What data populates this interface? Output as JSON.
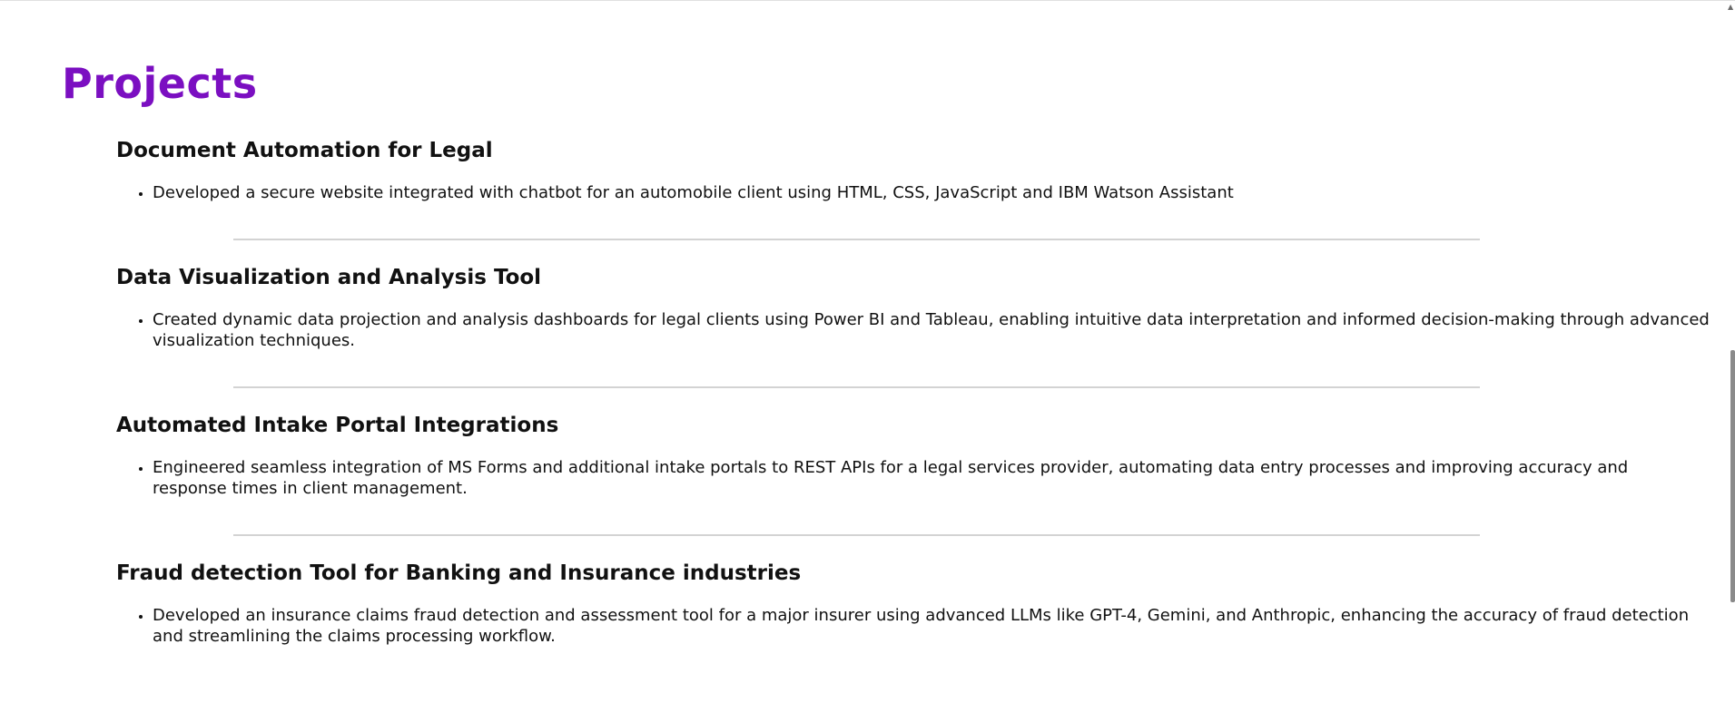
{
  "section": {
    "title": "Projects"
  },
  "projects": [
    {
      "title": "Document Automation for Legal",
      "bullets": [
        "Developed a secure website integrated with chatbot for an automobile client using HTML, CSS, JavaScript and IBM Watson Assistant"
      ]
    },
    {
      "title": "Data Visualization and Analysis Tool",
      "bullets": [
        "Created dynamic data projection and analysis dashboards for legal clients using Power BI and Tableau, enabling intuitive data interpretation and informed decision-making through advanced visualization techniques."
      ]
    },
    {
      "title": "Automated Intake Portal Integrations",
      "bullets": [
        "Engineered seamless integration of MS Forms and additional intake portals to REST APIs for a legal services provider, automating data entry processes and improving accuracy and response times in client management."
      ]
    },
    {
      "title": "Fraud detection Tool for Banking and Insurance industries",
      "bullets": [
        "Developed an insurance claims fraud detection and assessment tool for a major insurer using advanced LLMs like GPT-4, Gemini, and Anthropic, enhancing the accuracy of fraud detection and streamlining the claims processing workflow."
      ]
    }
  ],
  "icons": {
    "scroll_up": "scroll-up-arrow-icon"
  },
  "colors": {
    "title": "#7b0fc1",
    "divider": "#d3d3d3",
    "text": "#111111"
  }
}
